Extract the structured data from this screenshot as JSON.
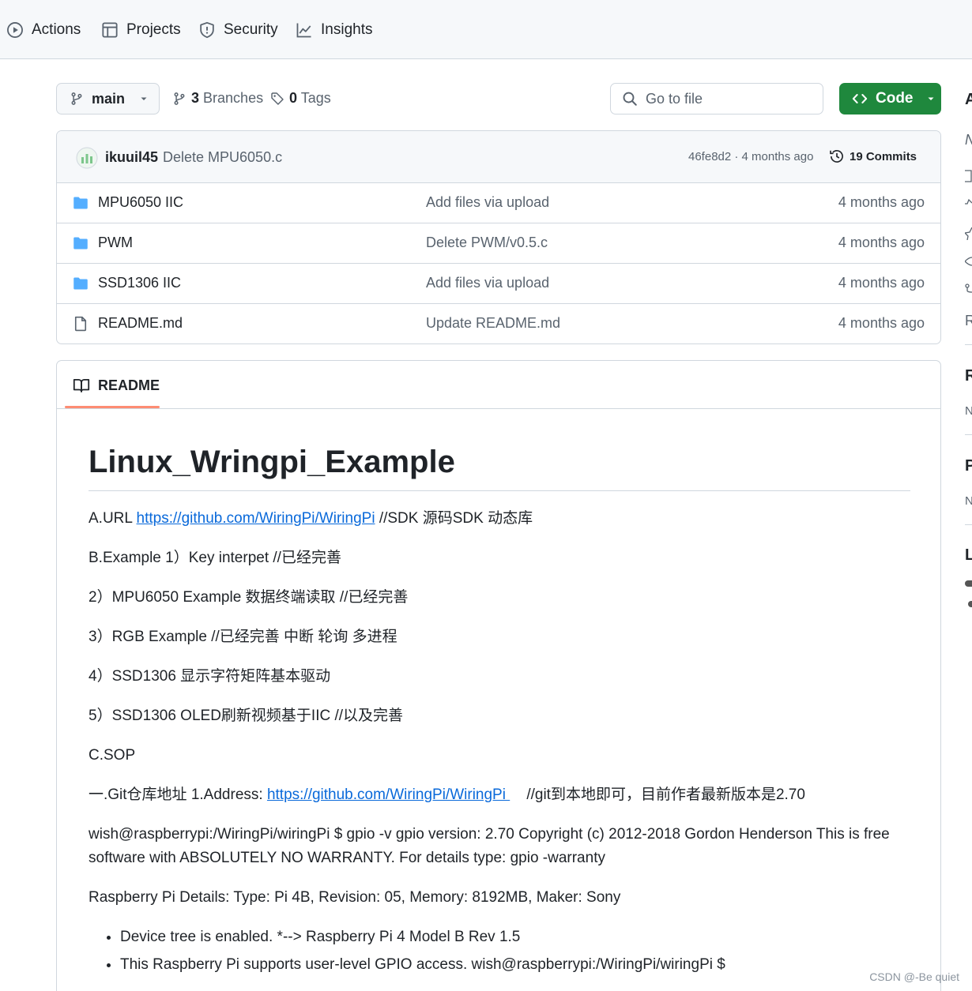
{
  "topnav": {
    "items": [
      {
        "label": "Actions",
        "icon": "play-circle-icon"
      },
      {
        "label": "Projects",
        "icon": "table-icon"
      },
      {
        "label": "Security",
        "icon": "shield-icon"
      },
      {
        "label": "Insights",
        "icon": "graph-icon"
      }
    ]
  },
  "toolbar": {
    "branch": "main",
    "branches_count": "3",
    "branches_label": "Branches",
    "tags_count": "0",
    "tags_label": "Tags",
    "search_placeholder": "Go to file",
    "code_label": "Code"
  },
  "commit": {
    "author": "ikuuil45",
    "message": "Delete MPU6050.c",
    "meta": "46fe8d2 · 4 months ago",
    "commits_label": "19 Commits"
  },
  "files": [
    {
      "name": "MPU6050 IIC",
      "type": "folder",
      "message": "Add files via upload",
      "date": "4 months ago"
    },
    {
      "name": "PWM",
      "type": "folder",
      "message": "Delete PWM/v0.5.c",
      "date": "4 months ago"
    },
    {
      "name": "SSD1306 IIC",
      "type": "folder",
      "message": "Add files via upload",
      "date": "4 months ago"
    },
    {
      "name": "README.md",
      "type": "file",
      "message": "Update README.md",
      "date": "4 months ago"
    }
  ],
  "readme": {
    "tab_label": "README",
    "title": "Linux_Wringpi_Example",
    "p1_prefix": "A.URL ",
    "p1_link": "https://github.com/WiringPi/WiringPi",
    "p1_suffix": " //SDK 源码SDK 动态库",
    "p2": "B.Example 1）Key interpet //已经完善",
    "p3": "2）MPU6050 Example 数据终端读取 //已经完善",
    "p4": "3）RGB Example //已经完善 中断 轮询 多进程",
    "p5": "4）SSD1306 显示字符矩阵基本驱动",
    "p6": "5）SSD1306 OLED刷新视频基于IIC //以及完善",
    "p7": "C.SOP",
    "p8_prefix": "一.Git仓库地址 1.Address: ",
    "p8_link": "https://github.com/WiringPi/WiringPi ",
    "p8_suffix": "    //git到本地即可，目前作者最新版本是2.70",
    "p9": "wish@raspberrypi:/WiringPi/wiringPi $ gpio -v gpio version: 2.70 Copyright (c) 2012-2018 Gordon Henderson This is free software with ABSOLUTELY NO WARRANTY. For details type: gpio -warranty",
    "p10": "Raspberry Pi Details: Type: Pi 4B, Revision: 05, Memory: 8192MB, Maker: Sony",
    "bullets": [
      "Device tree is enabled. *--> Raspberry Pi 4 Model B Rev 1.5",
      "This Raspberry Pi supports user-level GPIO access. wish@raspberrypi:/WiringPi/wiringPi $"
    ]
  },
  "sidebar_fragments": {
    "a": "A",
    "n1": "N",
    "r1": "R",
    "r2": "R",
    "n2": "N",
    "p": "P",
    "n3": "N",
    "l": "L"
  },
  "watermark": "CSDN @-Be quiet",
  "colors": {
    "code_button": "#1f883d",
    "link": "#0969da",
    "folder": "#54aeff",
    "tab_underline": "#fd8c73"
  }
}
